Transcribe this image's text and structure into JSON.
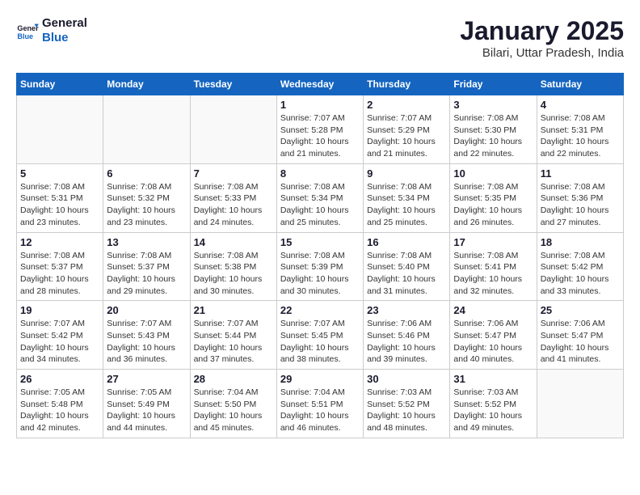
{
  "logo": {
    "text_general": "General",
    "text_blue": "Blue"
  },
  "header": {
    "title": "January 2025",
    "subtitle": "Bilari, Uttar Pradesh, India"
  },
  "weekdays": [
    "Sunday",
    "Monday",
    "Tuesday",
    "Wednesday",
    "Thursday",
    "Friday",
    "Saturday"
  ],
  "weeks": [
    [
      {
        "day": "",
        "sunrise": "",
        "sunset": "",
        "daylight": ""
      },
      {
        "day": "",
        "sunrise": "",
        "sunset": "",
        "daylight": ""
      },
      {
        "day": "",
        "sunrise": "",
        "sunset": "",
        "daylight": ""
      },
      {
        "day": "1",
        "sunrise": "Sunrise: 7:07 AM",
        "sunset": "Sunset: 5:28 PM",
        "daylight": "Daylight: 10 hours and 21 minutes."
      },
      {
        "day": "2",
        "sunrise": "Sunrise: 7:07 AM",
        "sunset": "Sunset: 5:29 PM",
        "daylight": "Daylight: 10 hours and 21 minutes."
      },
      {
        "day": "3",
        "sunrise": "Sunrise: 7:08 AM",
        "sunset": "Sunset: 5:30 PM",
        "daylight": "Daylight: 10 hours and 22 minutes."
      },
      {
        "day": "4",
        "sunrise": "Sunrise: 7:08 AM",
        "sunset": "Sunset: 5:31 PM",
        "daylight": "Daylight: 10 hours and 22 minutes."
      }
    ],
    [
      {
        "day": "5",
        "sunrise": "Sunrise: 7:08 AM",
        "sunset": "Sunset: 5:31 PM",
        "daylight": "Daylight: 10 hours and 23 minutes."
      },
      {
        "day": "6",
        "sunrise": "Sunrise: 7:08 AM",
        "sunset": "Sunset: 5:32 PM",
        "daylight": "Daylight: 10 hours and 23 minutes."
      },
      {
        "day": "7",
        "sunrise": "Sunrise: 7:08 AM",
        "sunset": "Sunset: 5:33 PM",
        "daylight": "Daylight: 10 hours and 24 minutes."
      },
      {
        "day": "8",
        "sunrise": "Sunrise: 7:08 AM",
        "sunset": "Sunset: 5:34 PM",
        "daylight": "Daylight: 10 hours and 25 minutes."
      },
      {
        "day": "9",
        "sunrise": "Sunrise: 7:08 AM",
        "sunset": "Sunset: 5:34 PM",
        "daylight": "Daylight: 10 hours and 25 minutes."
      },
      {
        "day": "10",
        "sunrise": "Sunrise: 7:08 AM",
        "sunset": "Sunset: 5:35 PM",
        "daylight": "Daylight: 10 hours and 26 minutes."
      },
      {
        "day": "11",
        "sunrise": "Sunrise: 7:08 AM",
        "sunset": "Sunset: 5:36 PM",
        "daylight": "Daylight: 10 hours and 27 minutes."
      }
    ],
    [
      {
        "day": "12",
        "sunrise": "Sunrise: 7:08 AM",
        "sunset": "Sunset: 5:37 PM",
        "daylight": "Daylight: 10 hours and 28 minutes."
      },
      {
        "day": "13",
        "sunrise": "Sunrise: 7:08 AM",
        "sunset": "Sunset: 5:37 PM",
        "daylight": "Daylight: 10 hours and 29 minutes."
      },
      {
        "day": "14",
        "sunrise": "Sunrise: 7:08 AM",
        "sunset": "Sunset: 5:38 PM",
        "daylight": "Daylight: 10 hours and 30 minutes."
      },
      {
        "day": "15",
        "sunrise": "Sunrise: 7:08 AM",
        "sunset": "Sunset: 5:39 PM",
        "daylight": "Daylight: 10 hours and 30 minutes."
      },
      {
        "day": "16",
        "sunrise": "Sunrise: 7:08 AM",
        "sunset": "Sunset: 5:40 PM",
        "daylight": "Daylight: 10 hours and 31 minutes."
      },
      {
        "day": "17",
        "sunrise": "Sunrise: 7:08 AM",
        "sunset": "Sunset: 5:41 PM",
        "daylight": "Daylight: 10 hours and 32 minutes."
      },
      {
        "day": "18",
        "sunrise": "Sunrise: 7:08 AM",
        "sunset": "Sunset: 5:42 PM",
        "daylight": "Daylight: 10 hours and 33 minutes."
      }
    ],
    [
      {
        "day": "19",
        "sunrise": "Sunrise: 7:07 AM",
        "sunset": "Sunset: 5:42 PM",
        "daylight": "Daylight: 10 hours and 34 minutes."
      },
      {
        "day": "20",
        "sunrise": "Sunrise: 7:07 AM",
        "sunset": "Sunset: 5:43 PM",
        "daylight": "Daylight: 10 hours and 36 minutes."
      },
      {
        "day": "21",
        "sunrise": "Sunrise: 7:07 AM",
        "sunset": "Sunset: 5:44 PM",
        "daylight": "Daylight: 10 hours and 37 minutes."
      },
      {
        "day": "22",
        "sunrise": "Sunrise: 7:07 AM",
        "sunset": "Sunset: 5:45 PM",
        "daylight": "Daylight: 10 hours and 38 minutes."
      },
      {
        "day": "23",
        "sunrise": "Sunrise: 7:06 AM",
        "sunset": "Sunset: 5:46 PM",
        "daylight": "Daylight: 10 hours and 39 minutes."
      },
      {
        "day": "24",
        "sunrise": "Sunrise: 7:06 AM",
        "sunset": "Sunset: 5:47 PM",
        "daylight": "Daylight: 10 hours and 40 minutes."
      },
      {
        "day": "25",
        "sunrise": "Sunrise: 7:06 AM",
        "sunset": "Sunset: 5:47 PM",
        "daylight": "Daylight: 10 hours and 41 minutes."
      }
    ],
    [
      {
        "day": "26",
        "sunrise": "Sunrise: 7:05 AM",
        "sunset": "Sunset: 5:48 PM",
        "daylight": "Daylight: 10 hours and 42 minutes."
      },
      {
        "day": "27",
        "sunrise": "Sunrise: 7:05 AM",
        "sunset": "Sunset: 5:49 PM",
        "daylight": "Daylight: 10 hours and 44 minutes."
      },
      {
        "day": "28",
        "sunrise": "Sunrise: 7:04 AM",
        "sunset": "Sunset: 5:50 PM",
        "daylight": "Daylight: 10 hours and 45 minutes."
      },
      {
        "day": "29",
        "sunrise": "Sunrise: 7:04 AM",
        "sunset": "Sunset: 5:51 PM",
        "daylight": "Daylight: 10 hours and 46 minutes."
      },
      {
        "day": "30",
        "sunrise": "Sunrise: 7:03 AM",
        "sunset": "Sunset: 5:52 PM",
        "daylight": "Daylight: 10 hours and 48 minutes."
      },
      {
        "day": "31",
        "sunrise": "Sunrise: 7:03 AM",
        "sunset": "Sunset: 5:52 PM",
        "daylight": "Daylight: 10 hours and 49 minutes."
      },
      {
        "day": "",
        "sunrise": "",
        "sunset": "",
        "daylight": ""
      }
    ]
  ]
}
